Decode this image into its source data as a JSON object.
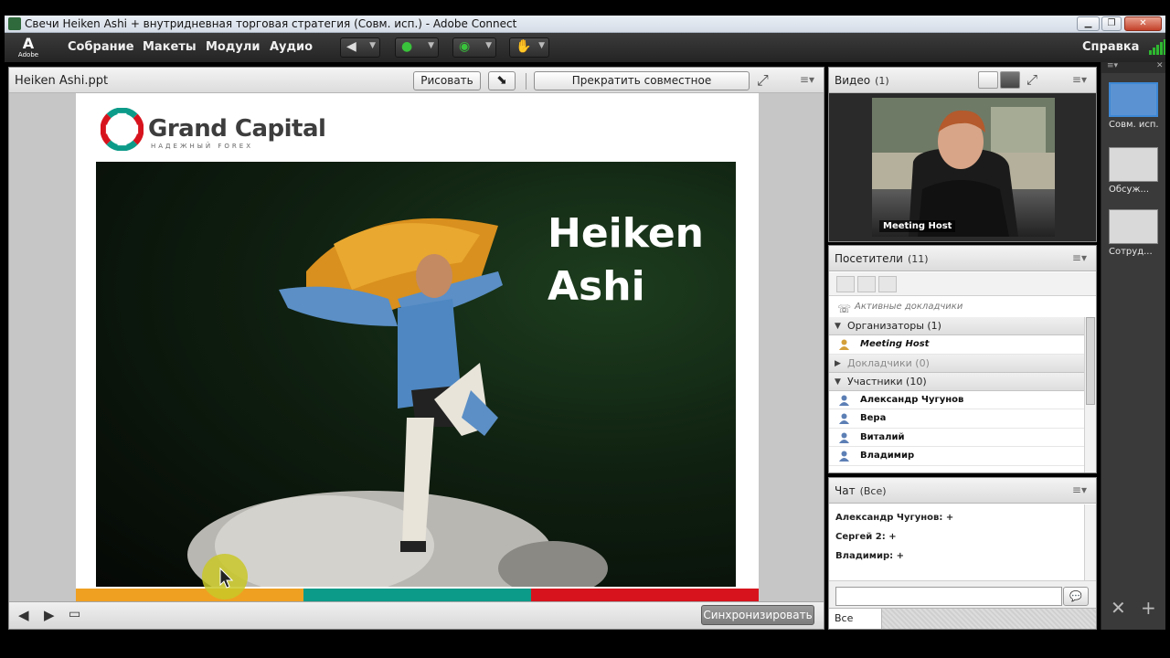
{
  "window": {
    "title": "Свечи Heiken Ashi + внутридневная торговая стратегия (Совм. исп.) - Adobe Connect",
    "minimize": "▁",
    "maximize": "❐",
    "close": "✕"
  },
  "menubar": {
    "logo_text": "Adobe",
    "items": [
      "Собрание",
      "Макеты",
      "Модули",
      "Аудио"
    ],
    "help": "Справка"
  },
  "share_pod": {
    "title": "Heiken Ashi.ppt",
    "draw_button": "Рисовать",
    "stop_button": "Прекратить совместное использование",
    "sync_button": "Синхронизировать"
  },
  "slide": {
    "logo_text": "Grand Capital",
    "logo_subtitle": "НАДЕЖНЫЙ FOREX",
    "title_line1": "Heiken",
    "title_line2": "Ashi",
    "colorbar": [
      "#f0a021",
      "#0d9b89",
      "#d7141e"
    ]
  },
  "video_pod": {
    "title": "Видео",
    "count": "(1)",
    "label": "Meeting Host"
  },
  "attendees_pod": {
    "title": "Посетители",
    "count": "(11)",
    "active_speakers": "Активные докладчики",
    "groups": {
      "hosts": "Организаторы (1)",
      "presenters": "Докладчики (0)",
      "participants": "Участники (10)"
    },
    "host": "Meeting Host",
    "participants": [
      "Александр Чугунов",
      "Вера",
      "Виталий",
      "Владимир"
    ]
  },
  "chat_pod": {
    "title": "Чат",
    "scope": "(Все)",
    "messages": [
      "Александр Чугунов: +",
      "Сергей 2: +",
      "Владимир: +"
    ],
    "input_value": "",
    "tab": "Все"
  },
  "layouts": {
    "items": [
      "Совм. исп.",
      "Обсуж...",
      "Сотруд..."
    ]
  },
  "colors": {
    "accent": "#3e88d6",
    "signal": "#2eb830"
  }
}
